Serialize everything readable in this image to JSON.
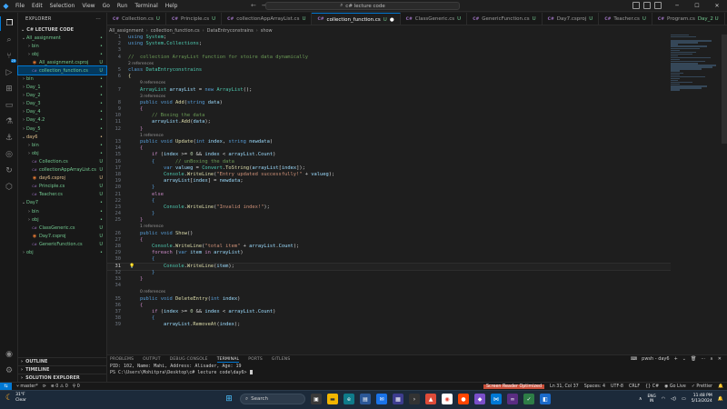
{
  "titlebar": {
    "menu": [
      "File",
      "Edit",
      "Selection",
      "View",
      "Go",
      "Run",
      "Terminal",
      "Help"
    ],
    "search_text": "c# lecture code"
  },
  "sidebar": {
    "title": "EXPLORER",
    "root": "C# LECTURE CODE",
    "tree": [
      {
        "name": "All_assignment",
        "indent": 1,
        "chev": "⌄",
        "color": "green",
        "badge": "•"
      },
      {
        "name": "bin",
        "indent": 2,
        "chev": "›",
        "color": "green",
        "badge": "•"
      },
      {
        "name": "obj",
        "indent": 2,
        "chev": "›",
        "color": "green",
        "badge": "•"
      },
      {
        "name": "All_assignment.csproj",
        "indent": 2,
        "chev": "",
        "icon": "rss",
        "color": "green",
        "badge": "U"
      },
      {
        "name": "collection_function.cs",
        "indent": 2,
        "chev": "",
        "icon": "cs",
        "color": "green",
        "badge": "U",
        "selected": true
      },
      {
        "name": "bin",
        "indent": 1,
        "chev": "›",
        "color": "green",
        "badge": "•"
      },
      {
        "name": "Day_1",
        "indent": 1,
        "chev": "›",
        "color": "green",
        "badge": "•"
      },
      {
        "name": "Day_2",
        "indent": 1,
        "chev": "›",
        "color": "green",
        "badge": "•"
      },
      {
        "name": "Day_3",
        "indent": 1,
        "chev": "›",
        "color": "green",
        "badge": "•"
      },
      {
        "name": "Day_4",
        "indent": 1,
        "chev": "›",
        "color": "green",
        "badge": "•"
      },
      {
        "name": "Day_4.2",
        "indent": 1,
        "chev": "›",
        "color": "green",
        "badge": "•"
      },
      {
        "name": "Day_5",
        "indent": 1,
        "chev": "›",
        "color": "green",
        "badge": "•"
      },
      {
        "name": "day6",
        "indent": 1,
        "chev": "⌄",
        "color": "orange",
        "badge": "•"
      },
      {
        "name": "bin",
        "indent": 2,
        "chev": "›",
        "color": "green",
        "badge": "•"
      },
      {
        "name": "obj",
        "indent": 2,
        "chev": "›",
        "color": "green",
        "badge": "•"
      },
      {
        "name": "Collection.cs",
        "indent": 2,
        "chev": "",
        "icon": "cs",
        "color": "green",
        "badge": "U"
      },
      {
        "name": "collectionAppArrayList.cs",
        "indent": 2,
        "chev": "",
        "icon": "cs",
        "color": "green",
        "badge": "U"
      },
      {
        "name": "day6.csproj",
        "indent": 2,
        "chev": "",
        "icon": "rss",
        "color": "orange",
        "badge": "U"
      },
      {
        "name": "Principle.cs",
        "indent": 2,
        "chev": "",
        "icon": "cs",
        "color": "green",
        "badge": "U"
      },
      {
        "name": "Teacher.cs",
        "indent": 2,
        "chev": "",
        "icon": "cs",
        "color": "green",
        "badge": "U"
      },
      {
        "name": "Day7",
        "indent": 1,
        "chev": "⌄",
        "color": "green",
        "badge": "•"
      },
      {
        "name": "bin",
        "indent": 2,
        "chev": "›",
        "color": "green",
        "badge": "•"
      },
      {
        "name": "obj",
        "indent": 2,
        "chev": "›",
        "color": "green",
        "badge": "•"
      },
      {
        "name": "ClassGeneric.cs",
        "indent": 2,
        "chev": "",
        "icon": "cs",
        "color": "green",
        "badge": "U"
      },
      {
        "name": "Day7.csproj",
        "indent": 2,
        "chev": "",
        "icon": "rss",
        "color": "green",
        "badge": "U"
      },
      {
        "name": "GenericFunction.cs",
        "indent": 2,
        "chev": "",
        "icon": "cs",
        "color": "green",
        "badge": "U"
      },
      {
        "name": "obj",
        "indent": 1,
        "chev": "›",
        "color": "green",
        "badge": "•"
      }
    ],
    "bottom_sections": [
      "OUTLINE",
      "TIMELINE",
      "SOLUTION EXPLORER"
    ]
  },
  "tabs": [
    {
      "label": "Collection.cs",
      "status": "U",
      "active": false
    },
    {
      "label": "Principle.cs",
      "status": "U",
      "active": false
    },
    {
      "label": "collectionAppArrayList.cs",
      "status": "U",
      "active": false
    },
    {
      "label": "collection_function.cs",
      "status": "U",
      "active": true
    },
    {
      "label": "ClassGeneric.cs",
      "status": "U",
      "active": false
    },
    {
      "label": "GenericFunction.cs",
      "status": "U",
      "active": false
    },
    {
      "label": "Day7.csproj",
      "status": "U",
      "active": false
    },
    {
      "label": "Teacher.cs",
      "status": "U",
      "active": false
    },
    {
      "label": "Program.cs",
      "status": "Day_2 U",
      "active": false
    },
    {
      "label": "Ir",
      "status": "",
      "active": false
    }
  ],
  "breadcrumb": [
    "All_assignment",
    "collection_function.cs",
    "DataEntryconstrains",
    "show"
  ],
  "code_lines": [
    {
      "n": "1",
      "html": "<span class='k'>using</span> <span class='t'>System</span>;"
    },
    {
      "n": "2",
      "html": "<span class='k'>using</span> <span class='t'>System</span>.<span class='t'>Collections</span>;"
    },
    {
      "n": "3",
      "html": ""
    },
    {
      "n": "4",
      "html": "<span class='c'>//  collection ArrayList function for stoire data dynamically</span>"
    },
    {
      "lens": "2 references"
    },
    {
      "n": "5",
      "html": "<span class='k'>class</span> <span class='t'>DataEntryconstrains</span>"
    },
    {
      "n": "6",
      "html": "<span class='f'>{</span>"
    },
    {
      "lens": "9 references",
      "indent": 1
    },
    {
      "n": "7",
      "html": "    <span class='t'>ArrayList</span> <span class='v'>arrayList</span> = <span class='k'>new</span> <span class='t'>ArrayList</span>();"
    },
    {
      "lens": "3 references",
      "indent": 1
    },
    {
      "n": "8",
      "html": "    <span class='k'>public</span> <span class='k'>void</span> <span class='f'>Add</span>(<span class='k'>string</span> <span class='v'>data</span>)"
    },
    {
      "n": "9",
      "html": "    <span class='kc'>{</span>"
    },
    {
      "n": "10",
      "html": "        <span class='c'>// Boxing the data</span>"
    },
    {
      "n": "11",
      "html": "        <span class='v'>arrayList</span>.<span class='f'>Add</span>(<span class='v'>data</span>);"
    },
    {
      "n": "12",
      "html": "    <span class='kc'>}</span>"
    },
    {
      "lens": "1 reference",
      "indent": 1
    },
    {
      "n": "13",
      "html": "    <span class='k'>public</span> <span class='k'>void</span> <span class='f'>Update</span>(<span class='k'>int</span> <span class='v'>index</span>, <span class='k'>string</span> <span class='v'>newdata</span>)"
    },
    {
      "n": "14",
      "html": "    <span class='kc'>{</span>"
    },
    {
      "n": "15",
      "html": "        <span class='kc'>if</span> (<span class='v'>index</span> &gt;= <span class='n'>0</span> &amp;&amp; <span class='v'>index</span> &lt; <span class='v'>arrayList</span>.<span class='v'>Count</span>)"
    },
    {
      "n": "16",
      "html": "        <span class='k'>{</span>       <span class='c'>// unBoxing the data</span>"
    },
    {
      "n": "17",
      "html": "            <span class='k'>var</span> <span class='v'>valueg</span> = <span class='t'>Convert</span>.<span class='f'>ToString</span>(<span class='v'>arrayList</span>[<span class='v'>index</span>]);"
    },
    {
      "n": "18",
      "html": "            <span class='t'>Console</span>.<span class='f'>WriteLine</span>(<span class='s'>\"Entry updated successfully!\"</span> + <span class='v'>valueg</span>);"
    },
    {
      "n": "19",
      "html": "            <span class='v'>arrayList</span>[<span class='v'>index</span>] = <span class='v'>newdata</span>;"
    },
    {
      "n": "20",
      "html": "        <span class='k'>}</span>"
    },
    {
      "n": "21",
      "html": "        <span class='kc'>else</span>"
    },
    {
      "n": "22",
      "html": "        <span class='k'>{</span>"
    },
    {
      "n": "23",
      "html": "            <span class='t'>Console</span>.<span class='f'>WriteLine</span>(<span class='s'>\"Invalid index!\"</span>);"
    },
    {
      "n": "24",
      "html": "        <span class='k'>}</span>"
    },
    {
      "n": "25",
      "html": "    <span class='kc'>}</span>"
    },
    {
      "lens": "1 reference",
      "indent": 1
    },
    {
      "n": "26",
      "html": "    <span class='k'>public</span> <span class='k'>void</span> <span class='f'>Show</span>()"
    },
    {
      "n": "27",
      "html": "    <span class='kc'>{</span>"
    },
    {
      "n": "28",
      "html": "        <span class='t'>Console</span>.<span class='f'>WriteLine</span>(<span class='s'>\"total item\"</span> + <span class='v'>arrayList</span>.<span class='v'>Count</span>);"
    },
    {
      "n": "29",
      "html": "        <span class='kc'>foreach</span> (<span class='k'>var</span> <span class='v'>item</span> <span class='kc'>in</span> <span class='v'>arrayList</span>)"
    },
    {
      "n": "30",
      "html": "        <span class='k'>{</span>"
    },
    {
      "n": "31",
      "html": "            <span class='t'>Console</span>.<span class='f'>WriteLine</span>(<span class='v'>item</span>);",
      "current": true,
      "bulb": true
    },
    {
      "n": "32",
      "html": "        <span class='k'>}</span>"
    },
    {
      "n": "33",
      "html": "    <span class='kc'>}</span>"
    },
    {
      "n": "34",
      "html": ""
    },
    {
      "lens": "0 references",
      "indent": 1
    },
    {
      "n": "35",
      "html": "    <span class='k'>public</span> <span class='k'>void</span> <span class='f'>DeleteEntry</span>(<span class='k'>int</span> <span class='v'>index</span>)"
    },
    {
      "n": "36",
      "html": "    <span class='kc'>{</span>"
    },
    {
      "n": "37",
      "html": "        <span class='kc'>if</span> (<span class='v'>index</span> &gt;= <span class='n'>0</span> &amp;&amp; <span class='v'>index</span> &lt; <span class='v'>arrayList</span>.<span class='v'>Count</span>)"
    },
    {
      "n": "38",
      "html": "        <span class='k'>{</span>"
    },
    {
      "n": "39",
      "html": "            <span class='v'>arrayList</span>.<span class='f'>RemoveAt</span>(<span class='v'>index</span>);"
    }
  ],
  "panel": {
    "tabs": [
      "PROBLEMS",
      "OUTPUT",
      "DEBUG CONSOLE",
      "TERMINAL",
      "PORTS",
      "GITLENS"
    ],
    "active_tab": "TERMINAL",
    "terminal_name": "pwsh - day6",
    "terminal_lines": [
      "PID: 102, Name: Mahi, Address: Alisader, Age: 19",
      "PS C:\\Users\\Mohitpra\\Desktop\\c# lecture code\\day6> "
    ]
  },
  "statusbar": {
    "branch": "master*",
    "sync": "⟳",
    "problems": "⊗ 0 ⚠ 0",
    "ports": "⚲ 0",
    "screen_reader": "Screen Reader Optimized",
    "position": "Ln 31, Col 37",
    "spaces": "Spaces: 4",
    "encoding": "UTF-8",
    "eol": "CRLF",
    "language": "{} C#",
    "golive": "Go Live",
    "prettier": "Prettier"
  },
  "taskbar": {
    "weather_temp": "31°F",
    "weather_desc": "Clear",
    "search_placeholder": "Search",
    "lang_top": "ENG",
    "lang_bottom": "IN",
    "time": "11:48 PM",
    "date": "5/13/2024"
  },
  "colors": {
    "accent": "#0078d4",
    "status_green": "#73c991",
    "status_orange": "#e2c08d"
  }
}
